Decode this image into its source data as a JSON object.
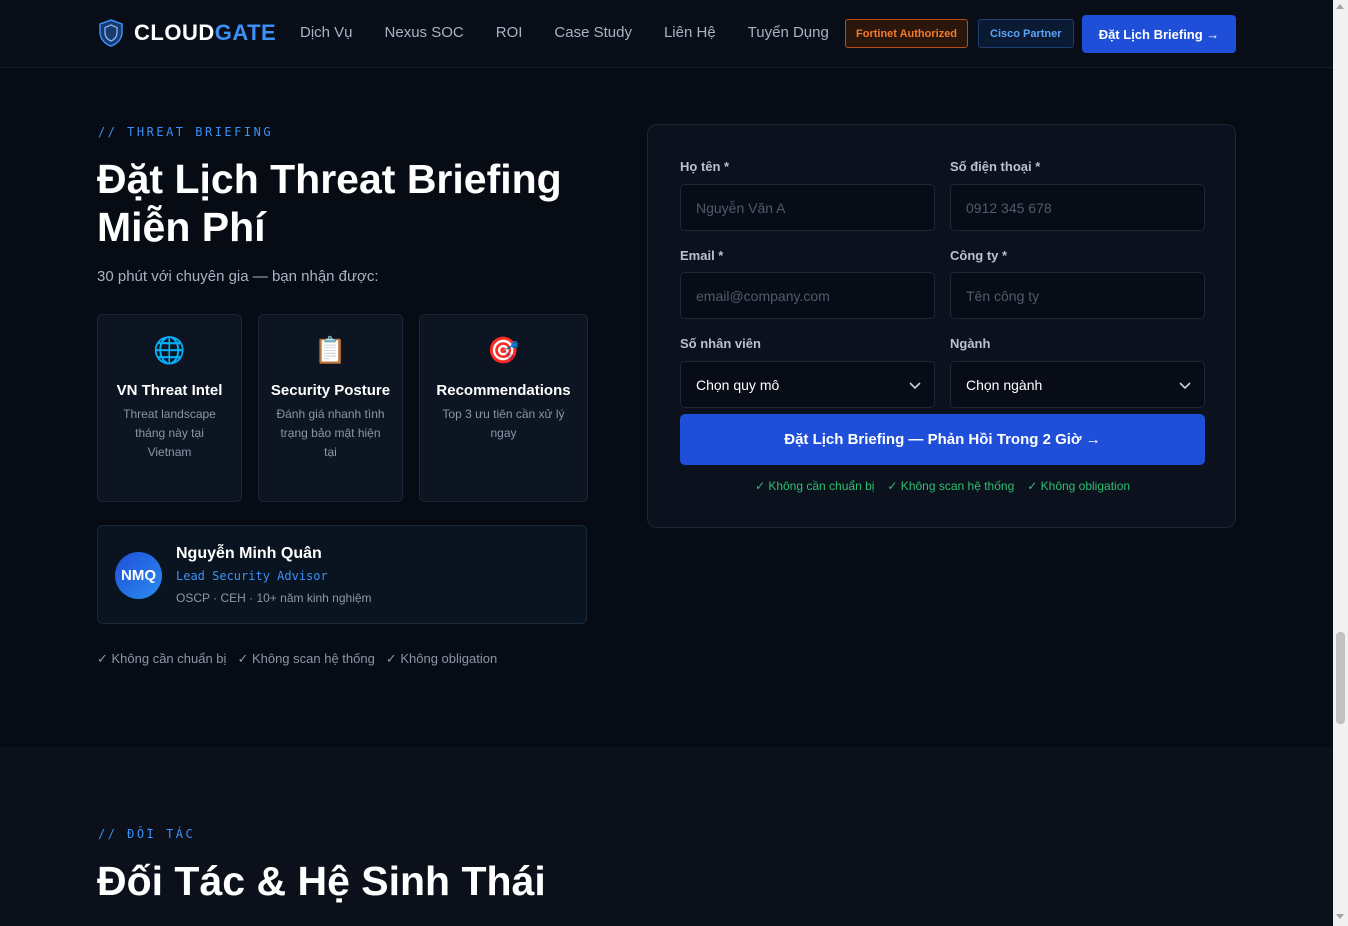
{
  "nav": {
    "logo_a": "CLOUD",
    "logo_b": "GATE",
    "links": [
      "Dịch Vụ",
      "Nexus SOC",
      "ROI",
      "Case Study",
      "Liên Hệ",
      "Tuyển Dụng"
    ],
    "badge_fortinet": "Fortinet Authorized",
    "badge_cisco": "Cisco Partner",
    "cta": "Đặt Lịch Briefing →"
  },
  "hero": {
    "eyebrow": "// THREAT BRIEFING",
    "title": "Đặt Lịch Threat Briefing Miễn Phí",
    "subtitle": "30 phút với chuyên gia — bạn nhận được:",
    "cards": [
      {
        "icon": "globe-icon",
        "glyph": "🌐",
        "title": "VN Threat Intel",
        "desc": "Threat landscape tháng này tại Vietnam"
      },
      {
        "icon": "clipboard-icon",
        "glyph": "📋",
        "title": "Security Posture",
        "desc": "Đánh giá nhanh tình trạng bảo mật hiện tại"
      },
      {
        "icon": "target-icon",
        "glyph": "🎯",
        "title": "Recommendations",
        "desc": "Top 3 ưu tiên cần xử lý ngay"
      }
    ],
    "advisor": {
      "initials": "NMQ",
      "name": "Nguyễn Minh Quân",
      "role": "Lead Security Advisor",
      "creds": "OSCP · CEH · 10+ năm kinh nghiệm"
    },
    "checks": [
      "✓ Không cần chuẩn bị",
      "✓ Không scan hệ thống",
      "✓ Không obligation"
    ]
  },
  "form": {
    "name_label": "Họ tên *",
    "name_placeholder": "Nguyễn Văn A",
    "phone_label": "Số điện thoại *",
    "phone_placeholder": "0912 345 678",
    "email_label": "Email *",
    "email_placeholder": "email@company.com",
    "company_label": "Công ty *",
    "company_placeholder": "Tên công ty",
    "size_label": "Số nhân viên",
    "size_value": "Chọn quy mô",
    "industry_label": "Ngành",
    "industry_value": "Chọn ngành",
    "submit": "Đặt Lịch Briefing — Phản Hồi Trong 2 Giờ →",
    "checks": [
      "✓ Không cần chuẩn bị",
      "✓ Không scan hệ thống",
      "✓ Không obligation"
    ]
  },
  "partners": {
    "eyebrow": "// ĐỐI TÁC",
    "title": "Đối Tác & Hệ Sinh Thái"
  },
  "colors": {
    "accent": "#1f4fd8",
    "brand_blue": "#3b8ff6",
    "fortinet": "#f47a2d",
    "success": "#2fbf71",
    "background": "#070b14"
  }
}
